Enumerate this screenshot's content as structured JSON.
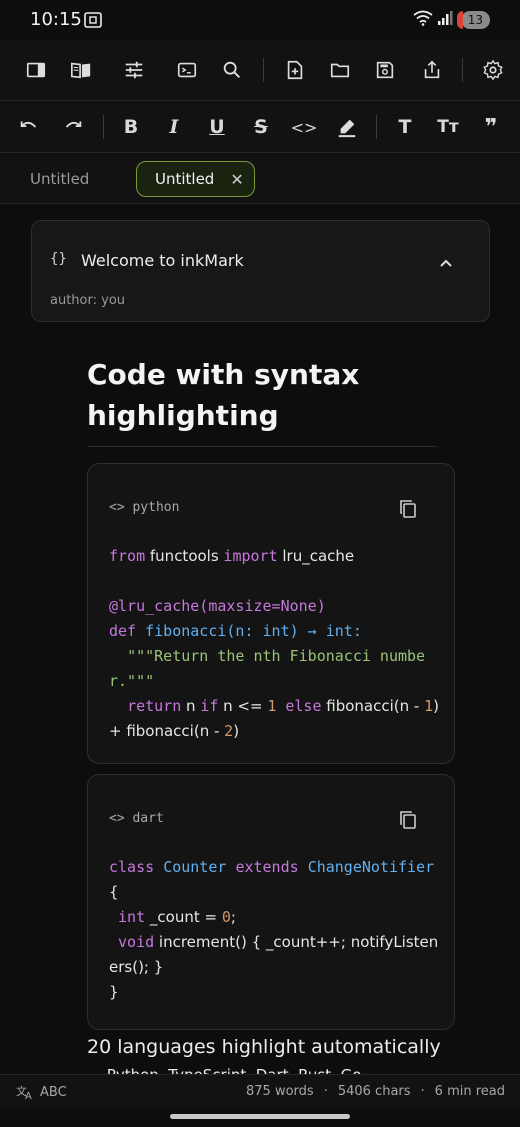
{
  "status_bar": {
    "time": "10:15",
    "battery": "13"
  },
  "toolbar_primary": {
    "icons": [
      "sidebar-icon",
      "reader-book-icon",
      "sliders-icon",
      "terminal-icon",
      "search-icon",
      "new-file-icon",
      "folder-icon",
      "save-icon",
      "share-icon",
      "settings-gear-icon"
    ]
  },
  "toolbar_format": {
    "bold": "B",
    "italic": "I",
    "underline": "U",
    "strike": "S",
    "code": "<>",
    "text": "T",
    "text_size": "Tт",
    "quote": "❞"
  },
  "tabs": [
    {
      "label": "Untitled",
      "active": false
    },
    {
      "label": "Untitled",
      "active": true
    }
  ],
  "frontmatter": {
    "icon": "{}",
    "title": "Welcome to inkMark",
    "meta": "author: you"
  },
  "document": {
    "heading": "Code with syntax highlighting",
    "paragraph": "20 languages highlight automatically",
    "paragraph_next": "— Python, TypeScript, Dart, Rust, Go"
  },
  "code_blocks": [
    {
      "language": "python",
      "lines": [
        [
          {
            "t": "from",
            "c": "kw"
          },
          {
            "t": " functools ",
            "c": "id"
          },
          {
            "t": "import",
            "c": "kw"
          },
          {
            "t": " lru_cache",
            "c": "id"
          }
        ],
        [],
        [
          {
            "t": "@lru_cache(maxsize=None)",
            "c": "kw"
          }
        ],
        [
          {
            "t": "def ",
            "c": "kw"
          },
          {
            "t": "fibonacci",
            "c": "fn"
          },
          {
            "t": "(n: int) → int:",
            "c": "fn"
          }
        ],
        [
          {
            "t": "  \"\"\"Return the nth Fibonacci number.\"\"\"",
            "c": "str"
          }
        ],
        [
          {
            "t": "  return",
            "c": "kw"
          },
          {
            "t": " n ",
            "c": "id"
          },
          {
            "t": "if",
            "c": "kw"
          },
          {
            "t": " n <= ",
            "c": "id"
          },
          {
            "t": "1",
            "c": "num"
          },
          {
            "t": " else",
            "c": "kw"
          },
          {
            "t": " fibonacci(n - ",
            "c": "id"
          },
          {
            "t": "1",
            "c": "num"
          },
          {
            "t": ") + fibonacci(n - ",
            "c": "id"
          },
          {
            "t": "2",
            "c": "num"
          },
          {
            "t": ")",
            "c": "id"
          }
        ]
      ]
    },
    {
      "language": "dart",
      "lines": [
        [
          {
            "t": "class ",
            "c": "kw"
          },
          {
            "t": "Counter ",
            "c": "fn"
          },
          {
            "t": "extends ",
            "c": "kw"
          },
          {
            "t": "ChangeNotifier",
            "c": "fn"
          },
          {
            "t": " {",
            "c": "id"
          }
        ],
        [
          {
            "t": " int",
            "c": "kw"
          },
          {
            "t": " _count = ",
            "c": "id"
          },
          {
            "t": "0",
            "c": "num"
          },
          {
            "t": ";",
            "c": "id"
          }
        ],
        [
          {
            "t": " void",
            "c": "kw"
          },
          {
            "t": " increment() { _count++; notifyListeners(); }",
            "c": "id"
          }
        ],
        [
          {
            "t": "}",
            "c": "id"
          }
        ]
      ]
    }
  ],
  "bottom_bar": {
    "input_lang": "ABC",
    "words": "875 words",
    "chars": "5406 chars",
    "read_time": "6 min read",
    "separator": "·"
  },
  "colors": {
    "accent_border": "#7a9a3a",
    "keyword": "#c678dd",
    "function": "#61afef",
    "string": "#98c379",
    "number": "#d19a66"
  }
}
